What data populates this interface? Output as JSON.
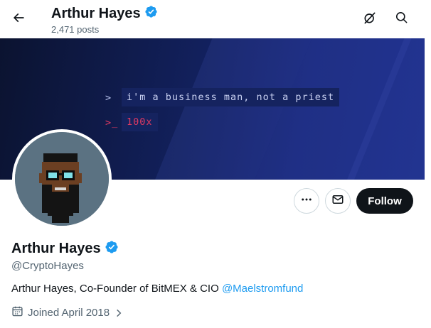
{
  "header": {
    "name": "Arthur Hayes",
    "posts_count": "2,471 posts",
    "back_icon": "arrow-left-icon",
    "verified_icon": "verified-badge-icon",
    "actions": [
      {
        "icon": "grok-icon"
      },
      {
        "icon": "search-icon"
      }
    ]
  },
  "banner": {
    "prompt1": ">",
    "line1": "i'm a business man, not a priest",
    "prompt2": ">_",
    "line2": "100x",
    "background_color": "#12205c",
    "line2_color": "#e23a62"
  },
  "profile": {
    "avatar_description_icon": "pixel-avatar-image",
    "name": "Arthur Hayes",
    "handle": "@CryptoHayes",
    "bio_text": "Arthur Hayes, Co-Founder of BitMEX & CIO ",
    "bio_link": "@Maelstromfund",
    "joined": "Joined April 2018",
    "joined_icon": "calendar-icon",
    "joined_chevron_icon": "chevron-right-icon"
  },
  "buttons": {
    "more_icon": "more-horizontal-icon",
    "message_icon": "envelope-icon",
    "follow_label": "Follow"
  },
  "colors": {
    "accent": "#1d9bf0",
    "text_primary": "#0f1419",
    "text_secondary": "#536471",
    "follow_bg": "#0f1419"
  }
}
